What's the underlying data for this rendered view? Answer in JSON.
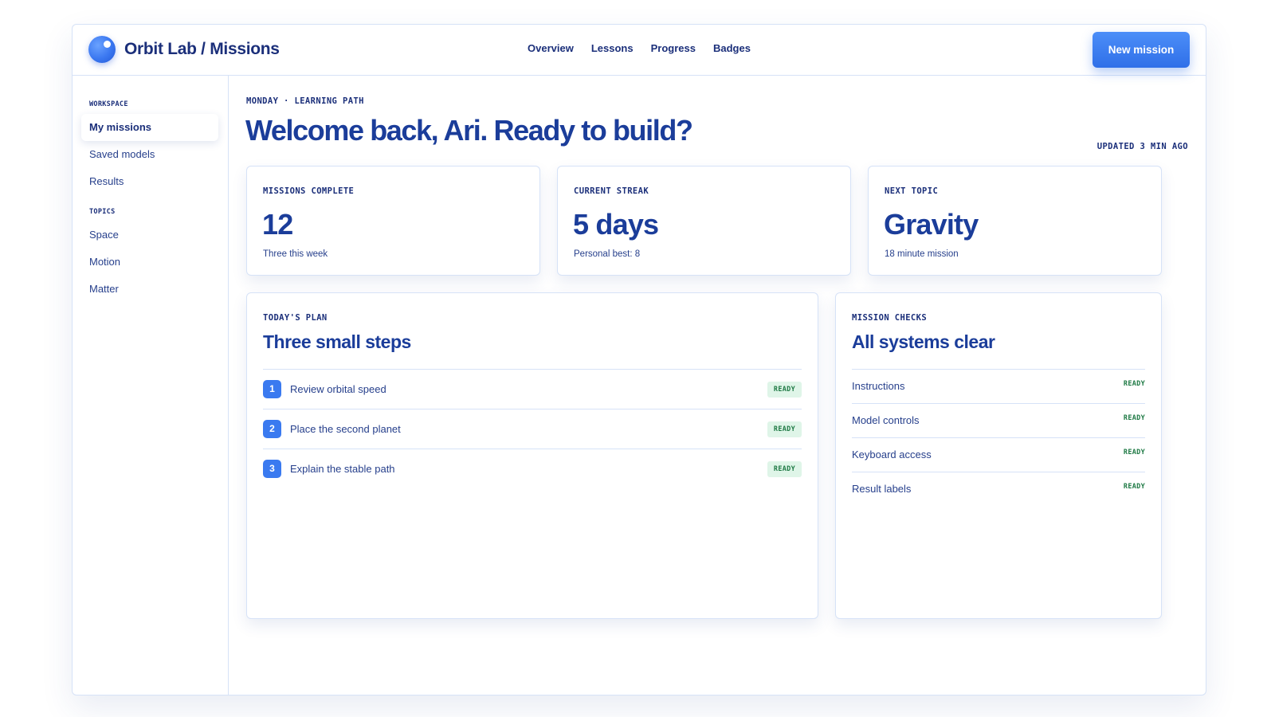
{
  "header": {
    "brand": "Orbit Lab / Missions",
    "nav": [
      "Overview",
      "Lessons",
      "Progress",
      "Badges"
    ],
    "cta_label": "New mission"
  },
  "sidebar": {
    "workspace_heading": "WORKSPACE",
    "workspace_items": [
      "My missions",
      "Saved models",
      "Results"
    ],
    "active_item": "My missions",
    "topics_heading": "TOPICS",
    "topic_items": [
      "Space",
      "Motion",
      "Matter"
    ]
  },
  "main": {
    "eyebrow": "MONDAY · LEARNING PATH",
    "title": "Welcome back, Ari. Ready to build?",
    "updated": "UPDATED 3 MIN AGO",
    "stats": [
      {
        "label": "MISSIONS COMPLETE",
        "value": "12",
        "sub": "Three this week"
      },
      {
        "label": "CURRENT STREAK",
        "value": "5 days",
        "sub": "Personal best: 8"
      },
      {
        "label": "NEXT TOPIC",
        "value": "Gravity",
        "sub": "18 minute mission"
      }
    ],
    "plan": {
      "label": "TODAY'S PLAN",
      "heading": "Three small steps",
      "steps": [
        {
          "num": "1",
          "text": "Review orbital speed",
          "status": "READY"
        },
        {
          "num": "2",
          "text": "Place the second planet",
          "status": "READY"
        },
        {
          "num": "3",
          "text": "Explain the stable path",
          "status": "READY"
        }
      ]
    },
    "checks": {
      "label": "MISSION CHECKS",
      "heading": "All systems clear",
      "items": [
        {
          "text": "Instructions",
          "status": "READY"
        },
        {
          "text": "Model controls",
          "status": "READY"
        },
        {
          "text": "Keyboard access",
          "status": "READY"
        },
        {
          "text": "Result labels",
          "status": "READY"
        }
      ]
    }
  },
  "colors": {
    "brand_navy": "#1b2f7a",
    "accent_blue": "#3a7af0",
    "ready_green_bg": "#dff5e8",
    "ready_green_text": "#1f7a45",
    "border": "#d6e2f7"
  }
}
